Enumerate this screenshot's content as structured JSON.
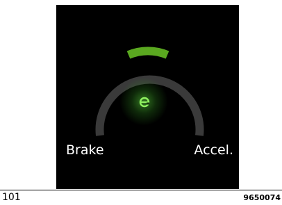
{
  "gauge": {
    "left_label": "Brake",
    "right_label": "Accel.",
    "center_icon": "eco-power-icon",
    "accent_color": "#5aa820",
    "track_color": "#3a3a3a",
    "active_segment": "center"
  },
  "footer": {
    "page_number": "101",
    "document_code": "9650074"
  }
}
